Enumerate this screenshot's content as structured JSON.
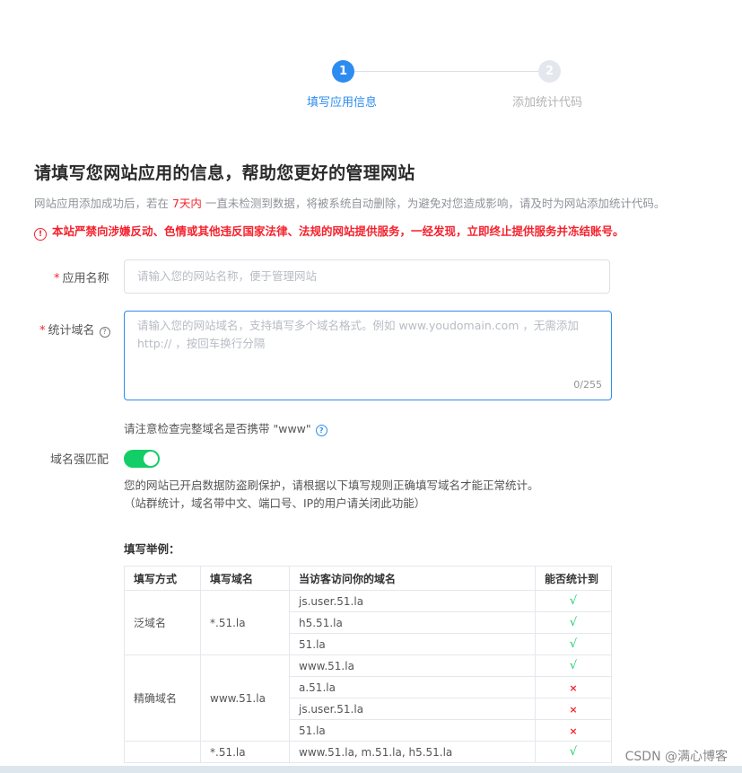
{
  "steps": [
    {
      "number": "1",
      "label": "填写应用信息"
    },
    {
      "number": "2",
      "label": "添加统计代码"
    }
  ],
  "heading": "请填写您网站应用的信息，帮助您更好的管理网站",
  "notice": {
    "before": "网站应用添加成功后，若在 ",
    "highlight": "7天内",
    "after": " 一直未检测到数据，将被系统自动删除，为避免对您造成影响，请及时为网站添加统计代码。"
  },
  "warning": "本站严禁向涉嫌反动、色情或其他违反国家法律、法规的网站提供服务，一经发现，立即终止提供服务并冻结账号。",
  "form": {
    "app_name": {
      "required_mark": "*",
      "label": "应用名称",
      "placeholder": "请输入您的网站名称，便于管理网站"
    },
    "domain": {
      "required_mark": "*",
      "label": "统计域名",
      "placeholder_line1": "请输入您的网站域名，支持填写多个域名格式。例如 www.youdomain.com ，无需添加",
      "placeholder_line2": "http:// ，按回车换行分隔",
      "counter": "0/255"
    },
    "hint": "请注意检查完整域名是否携带 \"www\"",
    "strict_match": {
      "label": "域名强匹配",
      "enabled": true
    },
    "description_line1": "您的网站已开启数据防盗刷保护，请根据以下填写规则正确填写域名才能正常统计。",
    "description_line2": "（站群统计，域名带中文、端口号、IP的用户请关闭此功能）"
  },
  "example": {
    "title": "填写举例：",
    "headers": [
      "填写方式",
      "填写域名",
      "当访客访问你的域名",
      "能否统计到"
    ],
    "groups": [
      {
        "method": "泛域名",
        "domain": "*.51.la",
        "rows": [
          {
            "visit": "js.user.51.la",
            "result": "√"
          },
          {
            "visit": "h5.51.la",
            "result": "√"
          },
          {
            "visit": "51.la",
            "result": "√"
          }
        ]
      },
      {
        "method": "精确域名",
        "domain": "www.51.la",
        "rows": [
          {
            "visit": "www.51.la",
            "result": "√"
          },
          {
            "visit": "a.51.la",
            "result": "×"
          },
          {
            "visit": "js.user.51.la",
            "result": "×"
          },
          {
            "visit": "51.la",
            "result": "×"
          }
        ]
      },
      {
        "method": "",
        "domain": "*.51.la",
        "rows": [
          {
            "visit": "www.51.la, m.51.la, h5.51.la",
            "result": "√"
          }
        ]
      }
    ]
  },
  "watermark": "CSDN @满心博客",
  "colors": {
    "primary": "#2d8cf0",
    "danger": "#f5222d",
    "success": "#13ce66"
  }
}
